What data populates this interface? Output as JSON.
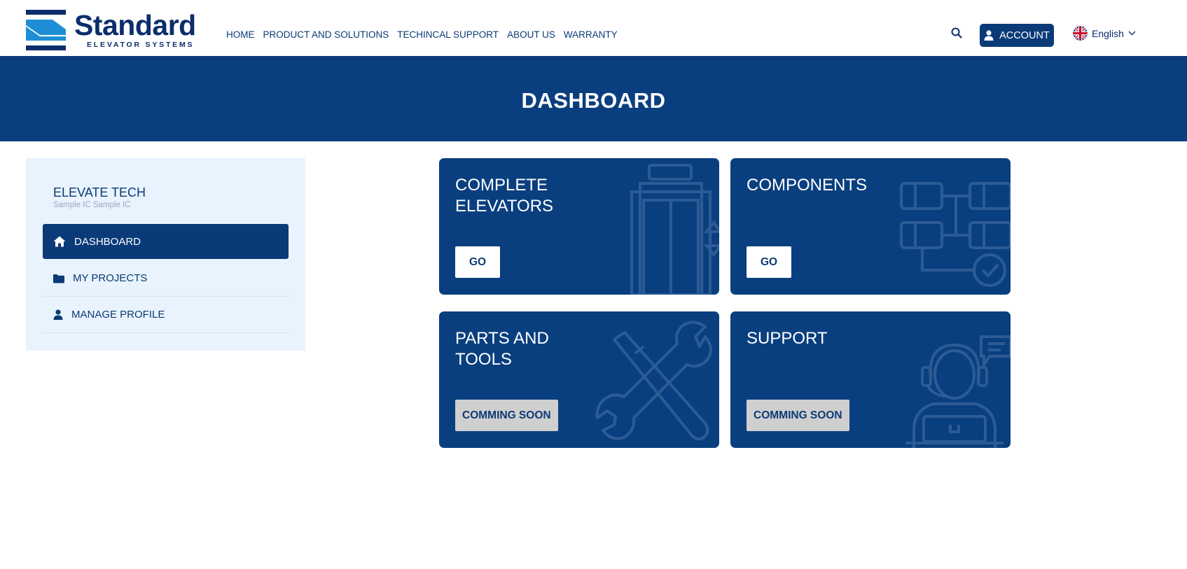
{
  "brand": {
    "name": "Standard",
    "tagline": "ELEVATOR SYSTEMS",
    "primary_color": "#0a3f7f",
    "accent_color": "#1e8fd6"
  },
  "nav": {
    "items": [
      "HOME",
      "PRODUCT AND SOLUTIONS",
      "TECHINCAL SUPPORT",
      "ABOUT US",
      "WARRANTY"
    ]
  },
  "header": {
    "search_icon": "search-icon",
    "account_label": "ACCOUNT",
    "language": "English"
  },
  "banner": {
    "title": "DASHBOARD"
  },
  "sidebar": {
    "company": "ELEVATE TECH",
    "subcompany": "Sample IC Sample IC",
    "items": [
      {
        "label": "DASHBOARD",
        "icon": "home-icon",
        "active": true
      },
      {
        "label": "MY PROJECTS",
        "icon": "folder-icon",
        "active": false
      },
      {
        "label": "MANAGE PROFILE",
        "icon": "user-icon",
        "active": false
      }
    ]
  },
  "cards": [
    {
      "title_line1": "COMPLETE",
      "title_line2": "ELEVATORS",
      "button": "GO",
      "icon": "elevator-icon"
    },
    {
      "title_line1": "COMPONENTS",
      "title_line2": "",
      "button": "GO",
      "icon": "components-icon"
    },
    {
      "title_line1": "PARTS AND",
      "title_line2": "TOOLS",
      "button": "COMMING SOON",
      "icon": "tools-icon"
    },
    {
      "title_line1": "SUPPORT",
      "title_line2": "",
      "button": "COMMING SOON",
      "icon": "support-agent-icon"
    }
  ]
}
